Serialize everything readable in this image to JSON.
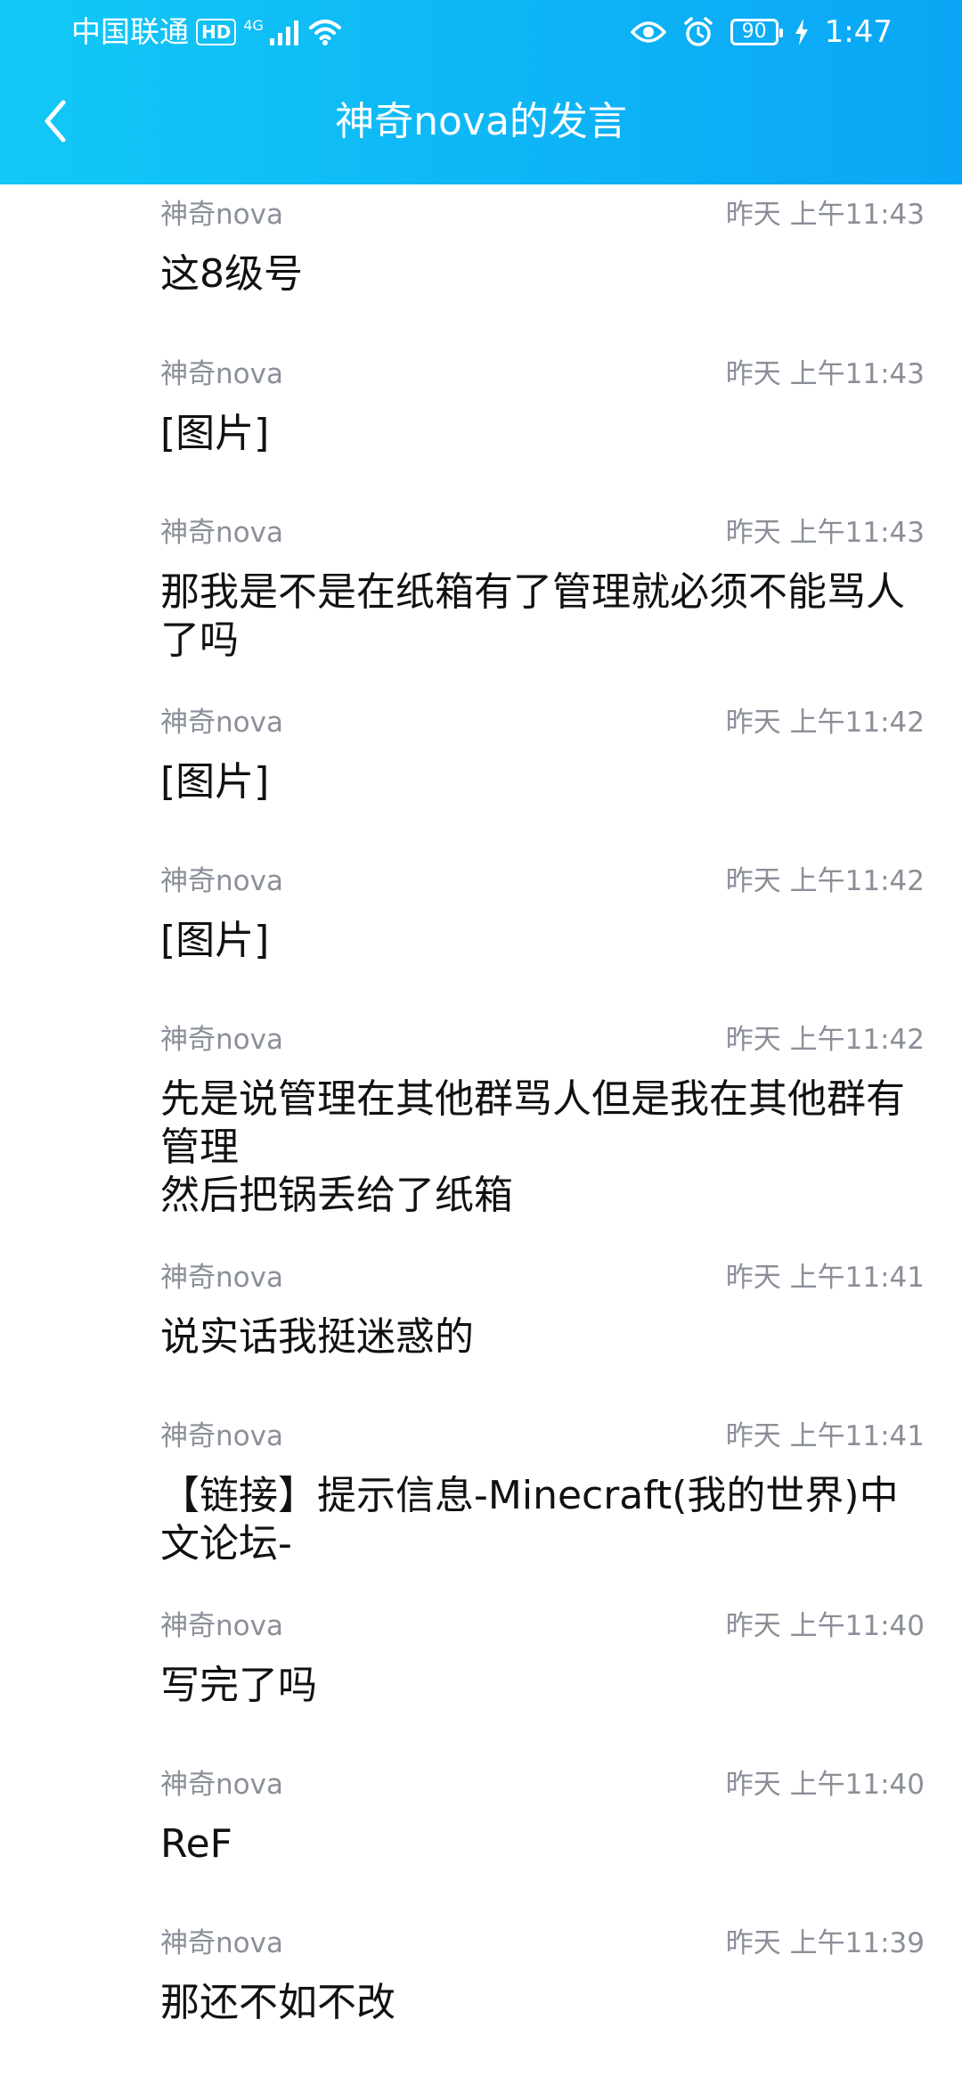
{
  "status_bar": {
    "carrier": "中国联通",
    "hd": "HD",
    "network": "4G",
    "battery": "90",
    "time": "1:47"
  },
  "header": {
    "title": "神奇nova的发言"
  },
  "messages": [
    {
      "author": "神奇nova",
      "time": "昨天 上午11:43",
      "text": "这8级号"
    },
    {
      "author": "神奇nova",
      "time": "昨天 上午11:43",
      "text": "[图片]"
    },
    {
      "author": "神奇nova",
      "time": "昨天 上午11:43",
      "text": "那我是不是在纸箱有了管理就必须不能骂人了吗"
    },
    {
      "author": "神奇nova",
      "time": "昨天 上午11:42",
      "text": "[图片]"
    },
    {
      "author": "神奇nova",
      "time": "昨天 上午11:42",
      "text": "[图片]"
    },
    {
      "author": "神奇nova",
      "time": "昨天 上午11:42",
      "text": "先是说管理在其他群骂人但是我在其他群有管理\n然后把锅丢给了纸箱"
    },
    {
      "author": "神奇nova",
      "time": "昨天 上午11:41",
      "text": "说实话我挺迷惑的"
    },
    {
      "author": "神奇nova",
      "time": "昨天 上午11:41",
      "text": "【链接】提示信息-Minecraft(我的世界)中文论坛-"
    },
    {
      "author": "神奇nova",
      "time": "昨天 上午11:40",
      "text": "写完了吗"
    },
    {
      "author": "神奇nova",
      "time": "昨天 上午11:40",
      "text": "ReF"
    },
    {
      "author": "神奇nova",
      "time": "昨天 上午11:39",
      "text": "那还不如不改"
    }
  ]
}
